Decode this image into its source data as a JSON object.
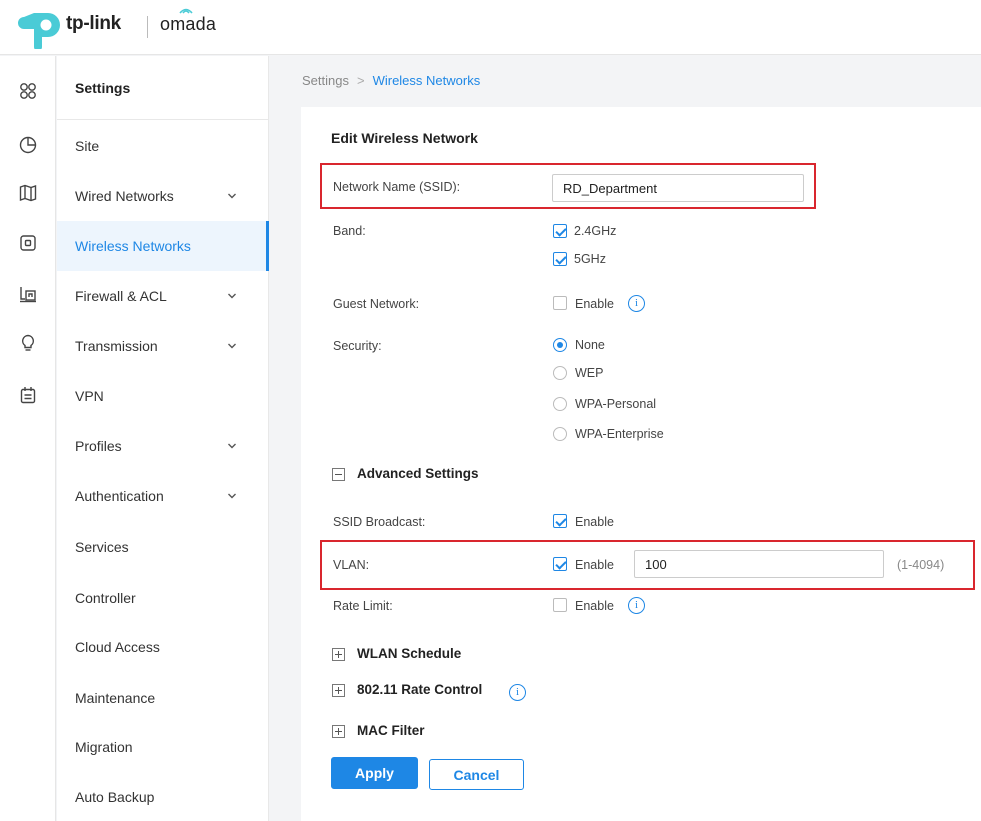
{
  "brand": {
    "logo_text": "tp-link",
    "product": "omada",
    "colors": {
      "accent": "#1e87e5",
      "logo": "#4acbd6",
      "highlight": "#d9262e"
    }
  },
  "rail": {
    "icons": [
      "dashboard-icon",
      "statistics-icon",
      "map-icon",
      "devices-icon",
      "insight-icon",
      "bulb-icon",
      "log-icon"
    ]
  },
  "sidebar": {
    "title": "Settings",
    "items": [
      {
        "label": "Site",
        "expandable": false
      },
      {
        "label": "Wired Networks",
        "expandable": true
      },
      {
        "label": "Wireless Networks",
        "expandable": false,
        "active": true
      },
      {
        "label": "Firewall & ACL",
        "expandable": true
      },
      {
        "label": "Transmission",
        "expandable": true
      },
      {
        "label": "VPN",
        "expandable": false
      },
      {
        "label": "Profiles",
        "expandable": true
      },
      {
        "label": "Authentication",
        "expandable": true
      },
      {
        "label": "Services",
        "expandable": false
      },
      {
        "label": "Controller",
        "expandable": false
      },
      {
        "label": "Cloud Access",
        "expandable": false
      },
      {
        "label": "Maintenance",
        "expandable": false
      },
      {
        "label": "Migration",
        "expandable": false
      },
      {
        "label": "Auto Backup",
        "expandable": false
      }
    ]
  },
  "breadcrumb": {
    "root": "Settings",
    "separator": ">",
    "current": "Wireless Networks"
  },
  "form": {
    "title": "Edit Wireless Network",
    "ssid": {
      "label": "Network Name (SSID):",
      "value": "RD_Department"
    },
    "band": {
      "label": "Band:",
      "options": [
        {
          "label": "2.4GHz",
          "checked": true
        },
        {
          "label": "5GHz",
          "checked": true
        }
      ]
    },
    "guest": {
      "label": "Guest Network:",
      "option": "Enable",
      "checked": false,
      "info": "i"
    },
    "security": {
      "label": "Security:",
      "options": [
        "None",
        "WEP",
        "WPA-Personal",
        "WPA-Enterprise"
      ],
      "selected": "None"
    },
    "advanced": {
      "title": "Advanced Settings",
      "expanded": true,
      "ssid_broadcast": {
        "label": "SSID Broadcast:",
        "option": "Enable",
        "checked": true
      },
      "vlan": {
        "label": "VLAN:",
        "option": "Enable",
        "checked": true,
        "value": "100",
        "range": "(1-4094)"
      },
      "rate_limit": {
        "label": "Rate Limit:",
        "option": "Enable",
        "checked": false,
        "info": "i"
      }
    },
    "sections": [
      {
        "title": "WLAN Schedule",
        "expanded": false,
        "info": false
      },
      {
        "title": "802.11 Rate Control",
        "expanded": false,
        "info": true
      },
      {
        "title": "MAC Filter",
        "expanded": false,
        "info": false
      }
    ],
    "info_glyph": "i",
    "apply_label": "Apply",
    "cancel_label": "Cancel"
  }
}
